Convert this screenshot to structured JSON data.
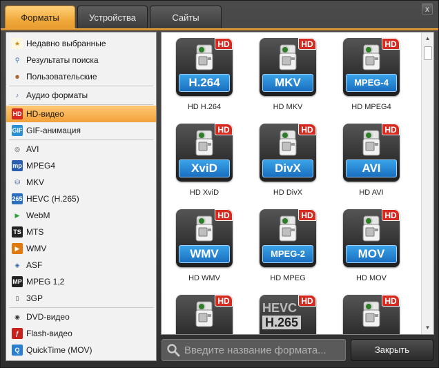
{
  "tabs": [
    {
      "label": "Форматы",
      "active": true
    },
    {
      "label": "Устройства",
      "active": false
    },
    {
      "label": "Сайты",
      "active": false
    }
  ],
  "window_close_glyph": "x",
  "sidebar": {
    "items": [
      {
        "label": "Недавно выбранные",
        "icon": "recent-icon",
        "group": 1
      },
      {
        "label": "Результаты поиска",
        "icon": "search-results-icon",
        "group": 1
      },
      {
        "label": "Пользовательские",
        "icon": "user-icon",
        "group": 1
      },
      {
        "label": "Аудио форматы",
        "icon": "note-icon",
        "group": 2
      },
      {
        "label": "HD-видео",
        "icon": "hd-icon",
        "group": 3,
        "selected": true
      },
      {
        "label": "GIF-анимация",
        "icon": "gif-icon",
        "group": 3
      },
      {
        "label": "AVI",
        "icon": "film-reel-icon",
        "group": 4
      },
      {
        "label": "MPEG4",
        "icon": "mpeg4-icon",
        "group": 4
      },
      {
        "label": "MKV",
        "icon": "mkv-icon",
        "group": 4
      },
      {
        "label": "HEVC (H.265)",
        "icon": "hevc-icon",
        "group": 4
      },
      {
        "label": "WebM",
        "icon": "play-icon",
        "group": 4
      },
      {
        "label": "MTS",
        "icon": "clapper-icon",
        "group": 4
      },
      {
        "label": "WMV",
        "icon": "wmv-icon",
        "group": 4
      },
      {
        "label": "ASF",
        "icon": "asf-icon",
        "group": 4
      },
      {
        "label": "MPEG 1,2",
        "icon": "mpeg-icon",
        "group": 4
      },
      {
        "label": "3GP",
        "icon": "phone-icon",
        "group": 4
      },
      {
        "label": "DVD-видео",
        "icon": "dvd-icon",
        "group": 5
      },
      {
        "label": "Flash-видео",
        "icon": "flash-icon",
        "group": 5
      },
      {
        "label": "QuickTime (MOV)",
        "icon": "quicktime-icon",
        "group": 5
      }
    ]
  },
  "formats": [
    {
      "badge": "H.264",
      "caption": "HD H.264"
    },
    {
      "badge": "MKV",
      "caption": "HD MKV"
    },
    {
      "badge": "MPEG-4",
      "caption": "HD MPEG4",
      "small": true
    },
    {
      "badge": "XviD",
      "caption": "HD XviD"
    },
    {
      "badge": "DivX",
      "caption": "HD DivX"
    },
    {
      "badge": "AVI",
      "caption": "HD AVI"
    },
    {
      "badge": "WMV",
      "caption": "HD WMV"
    },
    {
      "badge": "MPEG-2",
      "caption": "HD MPEG",
      "small": true
    },
    {
      "badge": "MOV",
      "caption": "HD MOV"
    },
    {
      "badge": "",
      "caption": ""
    },
    {
      "badge": "",
      "caption": "",
      "hevc": true,
      "hevc_top": "HEVC",
      "hevc_bottom": "H.265"
    },
    {
      "badge": "",
      "caption": ""
    }
  ],
  "hd_label": "HD",
  "search": {
    "placeholder": "Введите название формата..."
  },
  "close_button": "Закрыть",
  "colors": {
    "accent": "#f0a93c",
    "hd_badge": "#d42a1f",
    "format_badge": "#1a6fc0"
  }
}
